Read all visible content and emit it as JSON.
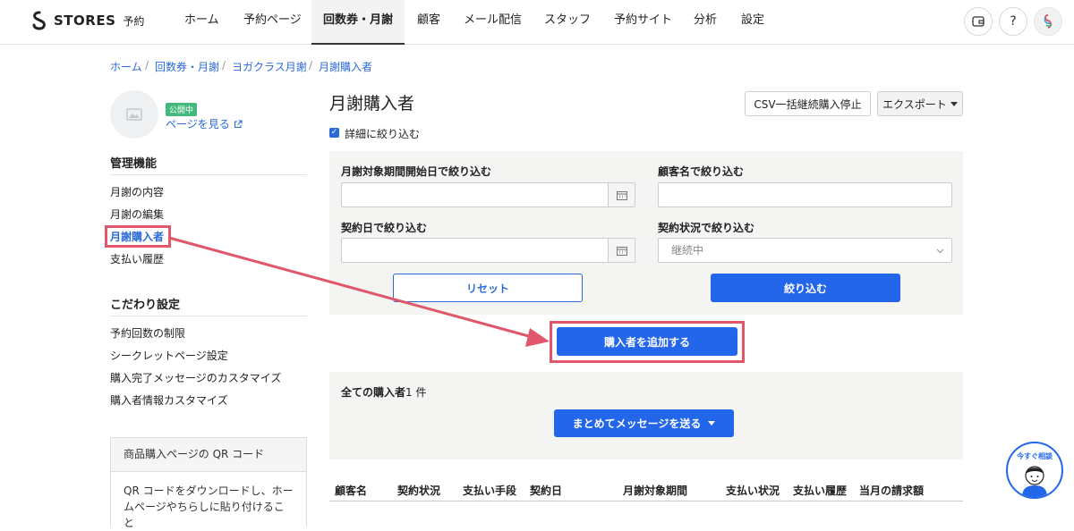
{
  "brand": {
    "name": "STORES",
    "sub": "予約"
  },
  "nav": {
    "items": [
      "ホーム",
      "予約ページ",
      "回数券・月謝",
      "顧客",
      "メール配信",
      "スタッフ",
      "予約サイト",
      "分析",
      "設定"
    ],
    "active": "回数券・月謝",
    "help_label": "?"
  },
  "breadcrumb": [
    "ホーム",
    "回数券・月謝",
    "ヨガクラス月謝",
    "月謝購入者"
  ],
  "sidebar": {
    "status_badge": "公開中",
    "view_page_link": "ページを見る",
    "sections": [
      {
        "title": "管理機能",
        "items": [
          "月謝の内容",
          "月謝の編集",
          "月謝購入者",
          "支払い履歴"
        ]
      },
      {
        "title": "こだわり設定",
        "items": [
          "予約回数の制限",
          "シークレットページ設定",
          "購入完了メッセージのカスタマイズ",
          "購入者情報カスタマイズ"
        ]
      }
    ],
    "active_item": "月謝購入者",
    "qr": {
      "title": "商品購入ページの QR コード",
      "body_line1": "QR コードをダウンロードし、ホー",
      "body_line2": "ムページやちらしに貼り付けること"
    }
  },
  "main": {
    "title": "月謝購入者",
    "csv_button": "CSV一括継続購入停止",
    "export_button": "エクスポート",
    "detail_filter_label": "詳細に絞り込む",
    "filters": {
      "period_label": "月謝対象期間開始日で絞り込む",
      "customer_label": "顧客名で絞り込む",
      "contract_date_label": "契約日で絞り込む",
      "contract_status_label": "契約状況で絞り込む",
      "contract_status_value": "継続中",
      "reset_button": "リセット",
      "apply_button": "絞り込む"
    },
    "add_button": "購入者を追加する",
    "count_label": "全ての購入者",
    "count_value": "1 件",
    "bulk_message_button": "まとめてメッセージを送る",
    "table_headers": [
      "顧客名",
      "契約状況",
      "支払い手段",
      "契約日",
      "月謝対象期間",
      "支払い状況",
      "支払い履歴",
      "当月の請求額"
    ]
  },
  "help_widget": {
    "label": "今すぐ相談"
  },
  "colors": {
    "accent": "#2466ea",
    "highlight": "#e0566a",
    "badge": "#44b97c"
  }
}
